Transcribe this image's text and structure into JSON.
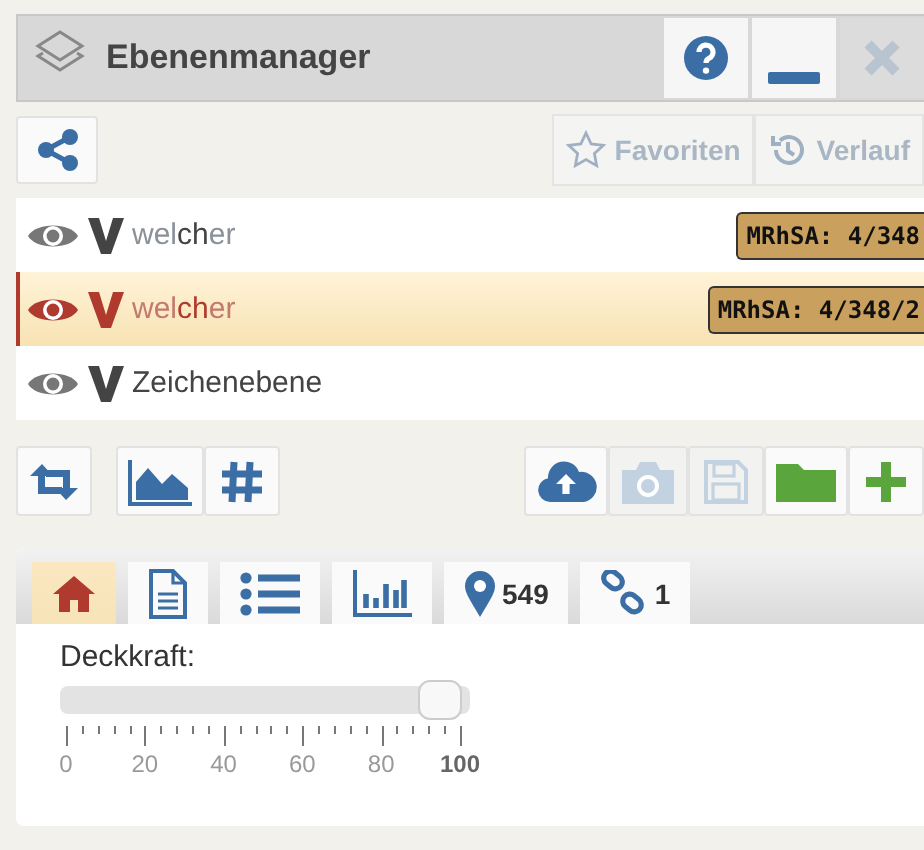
{
  "window": {
    "title": "Ebenenmanager"
  },
  "title_buttons": [
    {
      "kind": "help",
      "disabled": false
    },
    {
      "kind": "minimize",
      "disabled": false
    },
    {
      "kind": "close",
      "disabled": true
    }
  ],
  "top_toolbar": {
    "share": {
      "disabled": false
    },
    "links": [
      {
        "kind": "favorites",
        "label": "Favoriten",
        "disabled": true
      },
      {
        "kind": "history",
        "label": "Verlauf",
        "disabled": true
      }
    ]
  },
  "layers": [
    {
      "visible": true,
      "name": "wel**ch**er",
      "selected": false,
      "badge": "MRhSA: 4/348"
    },
    {
      "visible": true,
      "name": "wel**ch**er",
      "selected": true,
      "badge": "MRhSA: 4/348/2"
    },
    {
      "visible": true,
      "name": "Zeichenebene",
      "selected": false
    }
  ],
  "tools_left": [
    {
      "kind": "swap",
      "disabled": false
    },
    {
      "kind": "chart",
      "disabled": false
    },
    {
      "kind": "grid",
      "disabled": false
    }
  ],
  "tools_right": [
    {
      "kind": "upload",
      "disabled": false
    },
    {
      "kind": "camera",
      "disabled": true
    },
    {
      "kind": "save",
      "disabled": true
    },
    {
      "kind": "folder",
      "disabled": false
    },
    {
      "kind": "add",
      "disabled": false
    }
  ],
  "tabs": [
    {
      "kind": "home",
      "selected": true
    },
    {
      "kind": "document",
      "selected": false
    },
    {
      "kind": "list",
      "selected": false
    },
    {
      "kind": "stats",
      "selected": false
    },
    {
      "kind": "pin",
      "count": "549",
      "selected": false
    },
    {
      "kind": "link",
      "count": "1",
      "selected": false
    }
  ],
  "opacity": {
    "label": "Deckkraft:",
    "level": 1,
    "ticks": [
      {
        "label": "0",
        "current": false
      },
      {
        "label": "20",
        "current": false
      },
      {
        "label": "40",
        "current": false
      },
      {
        "label": "60",
        "current": false
      },
      {
        "label": "80",
        "current": false
      },
      {
        "label": "100",
        "current": true
      }
    ]
  }
}
